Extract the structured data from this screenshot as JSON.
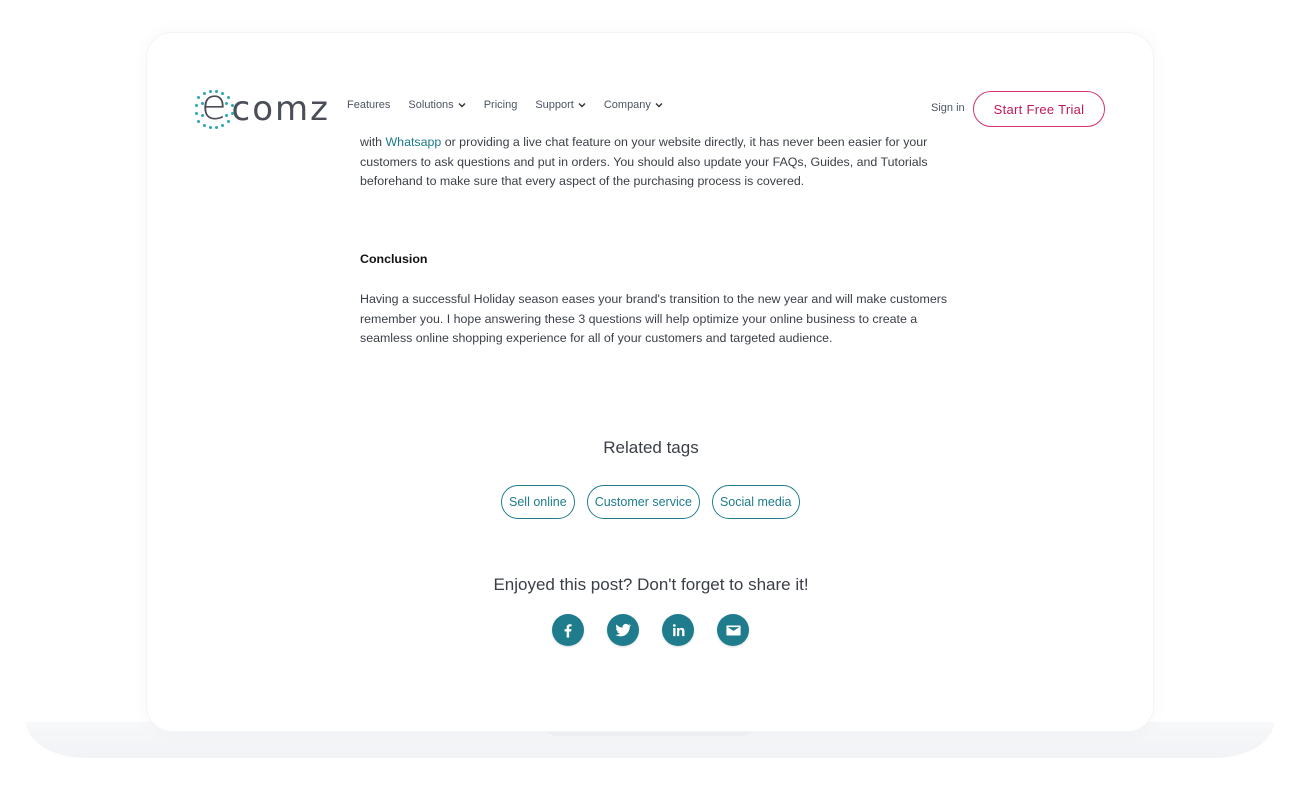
{
  "brand": {
    "logo_text": "comz",
    "logo_initial": "e"
  },
  "nav": {
    "items": [
      {
        "label": "Features",
        "dropdown": false
      },
      {
        "label": "Solutions",
        "dropdown": true
      },
      {
        "label": "Pricing",
        "dropdown": false
      },
      {
        "label": "Support",
        "dropdown": true
      },
      {
        "label": "Company",
        "dropdown": true
      }
    ],
    "signin_label": "Sign in",
    "trial_label": "Start Free Trial"
  },
  "article": {
    "p1_prefix": "with ",
    "p1_link": "Whatsapp",
    "p1_rest": " or providing a live chat feature on your website directly,  it has never been easier for your customers to ask questions and put in orders. You should also update your FAQs, Guides, and Tutorials beforehand to make sure that every aspect of the purchasing process is covered.",
    "conclusion_heading": "Conclusion",
    "p2": "Having a successful Holiday season eases your brand's transition to the new year and will make customers remember you. I hope answering these 3 questions will help optimize your online business to create a seamless online shopping experience for all of your customers and targeted audience."
  },
  "related": {
    "title": "Related tags",
    "tags": [
      "Sell online",
      "Customer service",
      "Social media"
    ]
  },
  "share": {
    "title": "Enjoyed this post? Don't forget to share it!",
    "buttons": [
      "facebook-icon",
      "twitter-icon",
      "linkedin-icon",
      "email-icon"
    ]
  },
  "colors": {
    "accent": "#1e7c8d",
    "cta": "#c2185b",
    "logo_dots": "#2aa7b5"
  }
}
